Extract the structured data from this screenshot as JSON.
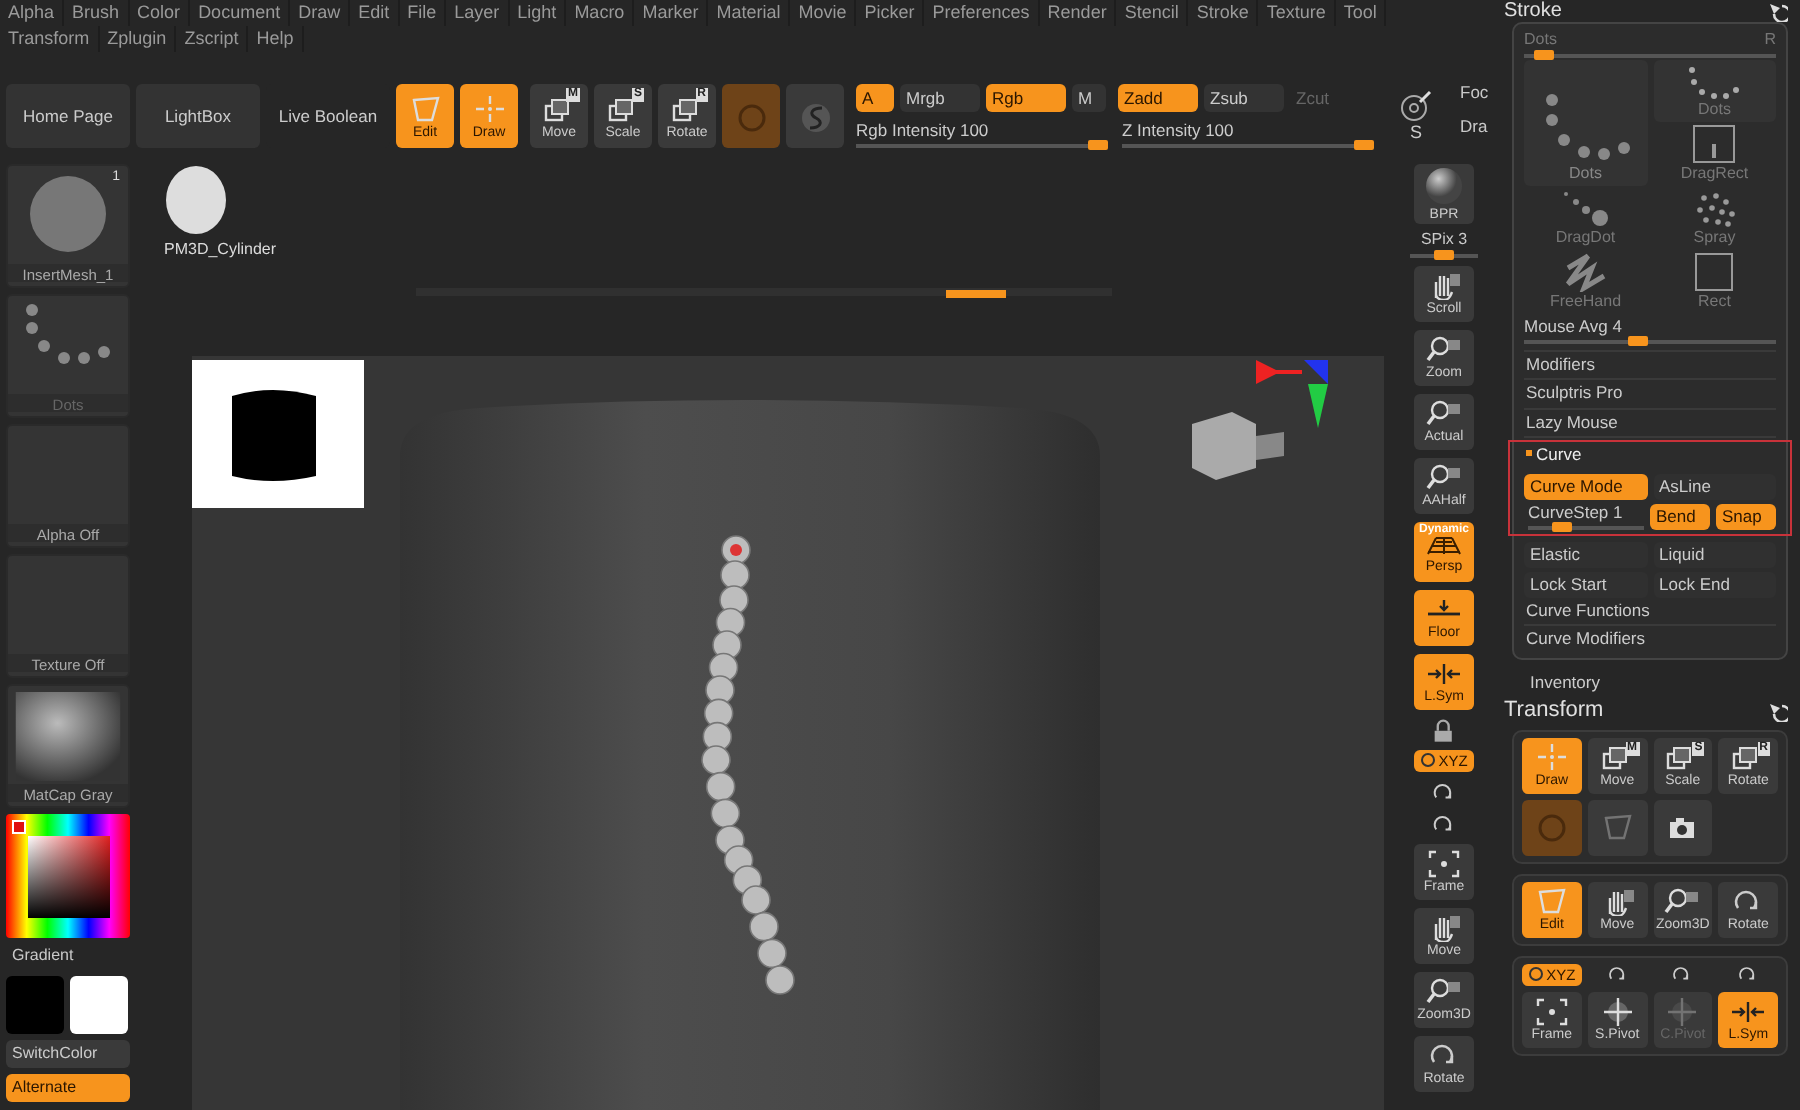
{
  "menu_rows": [
    [
      "Alpha",
      "Brush",
      "Color",
      "Document",
      "Draw",
      "Edit",
      "File",
      "Layer",
      "Light",
      "Macro",
      "Marker",
      "Material",
      "Movie",
      "Picker",
      "Preferences",
      "Render",
      "Stencil",
      "Stroke",
      "Texture",
      "Tool"
    ],
    [
      "Transform",
      "Zplugin",
      "Zscript",
      "Help"
    ]
  ],
  "toolbar": {
    "nav_buttons": [
      "Home Page",
      "LightBox",
      "Live Boolean"
    ],
    "tools": [
      {
        "label": "Edit",
        "on": true
      },
      {
        "label": "Draw",
        "on": true
      },
      {
        "label": "Move",
        "key": "M",
        "on": false
      },
      {
        "label": "Scale",
        "key": "S",
        "on": false
      },
      {
        "label": "Rotate",
        "key": "R",
        "on": false
      },
      {
        "on": true
      },
      {
        "on": false
      }
    ],
    "toggles": [
      {
        "label": "A",
        "on": true,
        "disabled": false
      },
      {
        "label": "Mrgb",
        "on": false,
        "disabled": false
      },
      {
        "label": "Rgb",
        "on": true,
        "disabled": false
      },
      {
        "label": "M",
        "on": false,
        "disabled": false
      },
      {
        "label": "Zadd",
        "on": true,
        "disabled": false
      },
      {
        "label": "Zsub",
        "on": false,
        "disabled": false
      },
      {
        "label": "Zcut",
        "on": false,
        "disabled": true
      }
    ],
    "sliders": [
      {
        "label": "Rgb Intensity 100",
        "level": 0.97
      },
      {
        "label": "Z Intensity 100",
        "level": 0.97
      }
    ],
    "focal": {
      "key": "S",
      "labels": [
        "Foc",
        "Dra"
      ]
    }
  },
  "left_shelf": {
    "tiles": [
      {
        "kind": "mesh",
        "label": "InsertMesh_1",
        "badge": "1",
        "disabled": false
      },
      {
        "kind": "dots",
        "label": "Dots",
        "disabled": true
      },
      {
        "kind": "blank",
        "label": "Alpha Off",
        "disabled": false
      },
      {
        "kind": "blank",
        "label": "Texture Off",
        "disabled": false
      },
      {
        "kind": "matcap",
        "label": "MatCap Gray",
        "disabled": false
      }
    ],
    "gradient_label": "Gradient",
    "swatches": [
      {
        "color": "#000000"
      },
      {
        "color": "#ffffff"
      }
    ],
    "buttons": [
      {
        "label": "SwitchColor",
        "on": false
      },
      {
        "label": "Alternate",
        "on": true
      }
    ]
  },
  "tool_thumbnails": [
    {
      "label": "PM3D_Cylinder"
    }
  ],
  "right_shelf": [
    {
      "kind": "sphere",
      "label": "BPR"
    },
    {
      "kind": "slider",
      "label": "SPix 3",
      "level": 0.5
    },
    {
      "kind": "button",
      "label": "Scroll",
      "on": false
    },
    {
      "kind": "button",
      "label": "Zoom",
      "on": false
    },
    {
      "kind": "button",
      "label": "Actual",
      "on": false
    },
    {
      "kind": "button",
      "label": "AAHalf",
      "on": false
    },
    {
      "kind": "button",
      "label": "Persp",
      "badge": "Dynamic",
      "on": true
    },
    {
      "kind": "button",
      "label": "Floor",
      "on": true
    },
    {
      "kind": "button",
      "label": "L.Sym",
      "on": true
    },
    {
      "kind": "icon"
    },
    {
      "kind": "pill",
      "label": "XYZ",
      "on": true
    },
    {
      "kind": "icon"
    },
    {
      "kind": "icon"
    },
    {
      "kind": "button",
      "label": "Frame",
      "on": false
    },
    {
      "kind": "button",
      "label": "Move",
      "on": false
    },
    {
      "kind": "button",
      "label": "Zoom3D",
      "on": false
    },
    {
      "kind": "button",
      "label": "Rotate",
      "on": false
    }
  ],
  "stroke_panel": {
    "title": "Stroke",
    "current": {
      "label": "Dots",
      "key": "R",
      "level": 0.08
    },
    "types": [
      {
        "kind": "dots",
        "label": "Dots",
        "selected": false
      },
      {
        "kind": "dots-large",
        "label": "Dots",
        "selected": true
      },
      {
        "kind": "drag-rect",
        "label": "DragRect",
        "selected": false
      },
      {
        "kind": "drag-dot",
        "label": "DragDot",
        "selected": false
      },
      {
        "kind": "spray",
        "label": "Spray",
        "selected": false
      },
      {
        "kind": "freehand",
        "label": "FreeHand",
        "selected": false
      },
      {
        "kind": "rect",
        "label": "Rect",
        "selected": false
      }
    ],
    "mouse_avg": {
      "label": "Mouse Avg 4",
      "level": 0.45
    },
    "sections": [
      "Modifiers",
      "Sculptris Pro",
      "Lazy Mouse"
    ],
    "curve": {
      "title": "Curve",
      "expanded": true,
      "highlighted_rows": [
        [
          {
            "kind": "toggle",
            "label": "Curve Mode",
            "on": true
          },
          {
            "kind": "toggle",
            "label": "AsLine",
            "on": false
          }
        ],
        [
          {
            "kind": "slider",
            "label": "CurveStep 1",
            "level": 0.3
          },
          {
            "kind": "toggle",
            "label": "Bend",
            "on": true
          },
          {
            "kind": "toggle",
            "label": "Snap",
            "on": true
          }
        ]
      ],
      "rows": [
        [
          {
            "kind": "toggle",
            "label": "Elastic",
            "on": false
          },
          {
            "kind": "toggle",
            "label": "Liquid",
            "on": false
          }
        ],
        [
          {
            "kind": "toggle",
            "label": "Lock Start",
            "on": false
          },
          {
            "kind": "toggle",
            "label": "Lock End",
            "on": false
          }
        ]
      ],
      "subsections": [
        "Curve Functions",
        "Curve Modifiers"
      ]
    }
  },
  "inventory": "Inventory",
  "transform_panel": {
    "title": "Transform",
    "groups": [
      {
        "items": [
          {
            "kind": "button",
            "label": "Draw",
            "on": true,
            "disabled": false
          },
          {
            "kind": "button",
            "key": "M",
            "label": "Move",
            "on": false,
            "disabled": false
          },
          {
            "kind": "button",
            "key": "S",
            "label": "Scale",
            "on": false,
            "disabled": false
          },
          {
            "kind": "button",
            "key": "R",
            "label": "Rotate",
            "on": false,
            "disabled": false
          },
          {
            "kind": "button",
            "on": true,
            "disabled": false
          },
          {
            "kind": "button",
            "on": false,
            "disabled": true
          },
          {
            "kind": "button",
            "on": false,
            "disabled": false
          }
        ]
      },
      {
        "items": [
          {
            "kind": "button",
            "label": "Edit",
            "on": true,
            "disabled": false
          },
          {
            "kind": "button",
            "label": "Move",
            "on": false,
            "disabled": false
          },
          {
            "kind": "button",
            "label": "Zoom3D",
            "on": false,
            "disabled": false
          },
          {
            "kind": "button",
            "label": "Rotate",
            "on": false,
            "disabled": false
          }
        ]
      },
      {
        "items": [
          {
            "kind": "pill",
            "label": "XYZ",
            "on": true,
            "disabled": false
          },
          {
            "kind": "small",
            "on": false,
            "disabled": false
          },
          {
            "kind": "small",
            "on": false,
            "disabled": false
          },
          {
            "kind": "small",
            "on": false,
            "disabled": false
          },
          {
            "kind": "button",
            "label": "Frame",
            "on": false,
            "disabled": false
          },
          {
            "kind": "button",
            "label": "S.Pivot",
            "on": false,
            "disabled": false
          },
          {
            "kind": "button",
            "label": "C.Pivot",
            "on": false,
            "disabled": true
          },
          {
            "kind": "button",
            "label": "L.Sym",
            "on": true,
            "disabled": false
          }
        ]
      }
    ]
  }
}
